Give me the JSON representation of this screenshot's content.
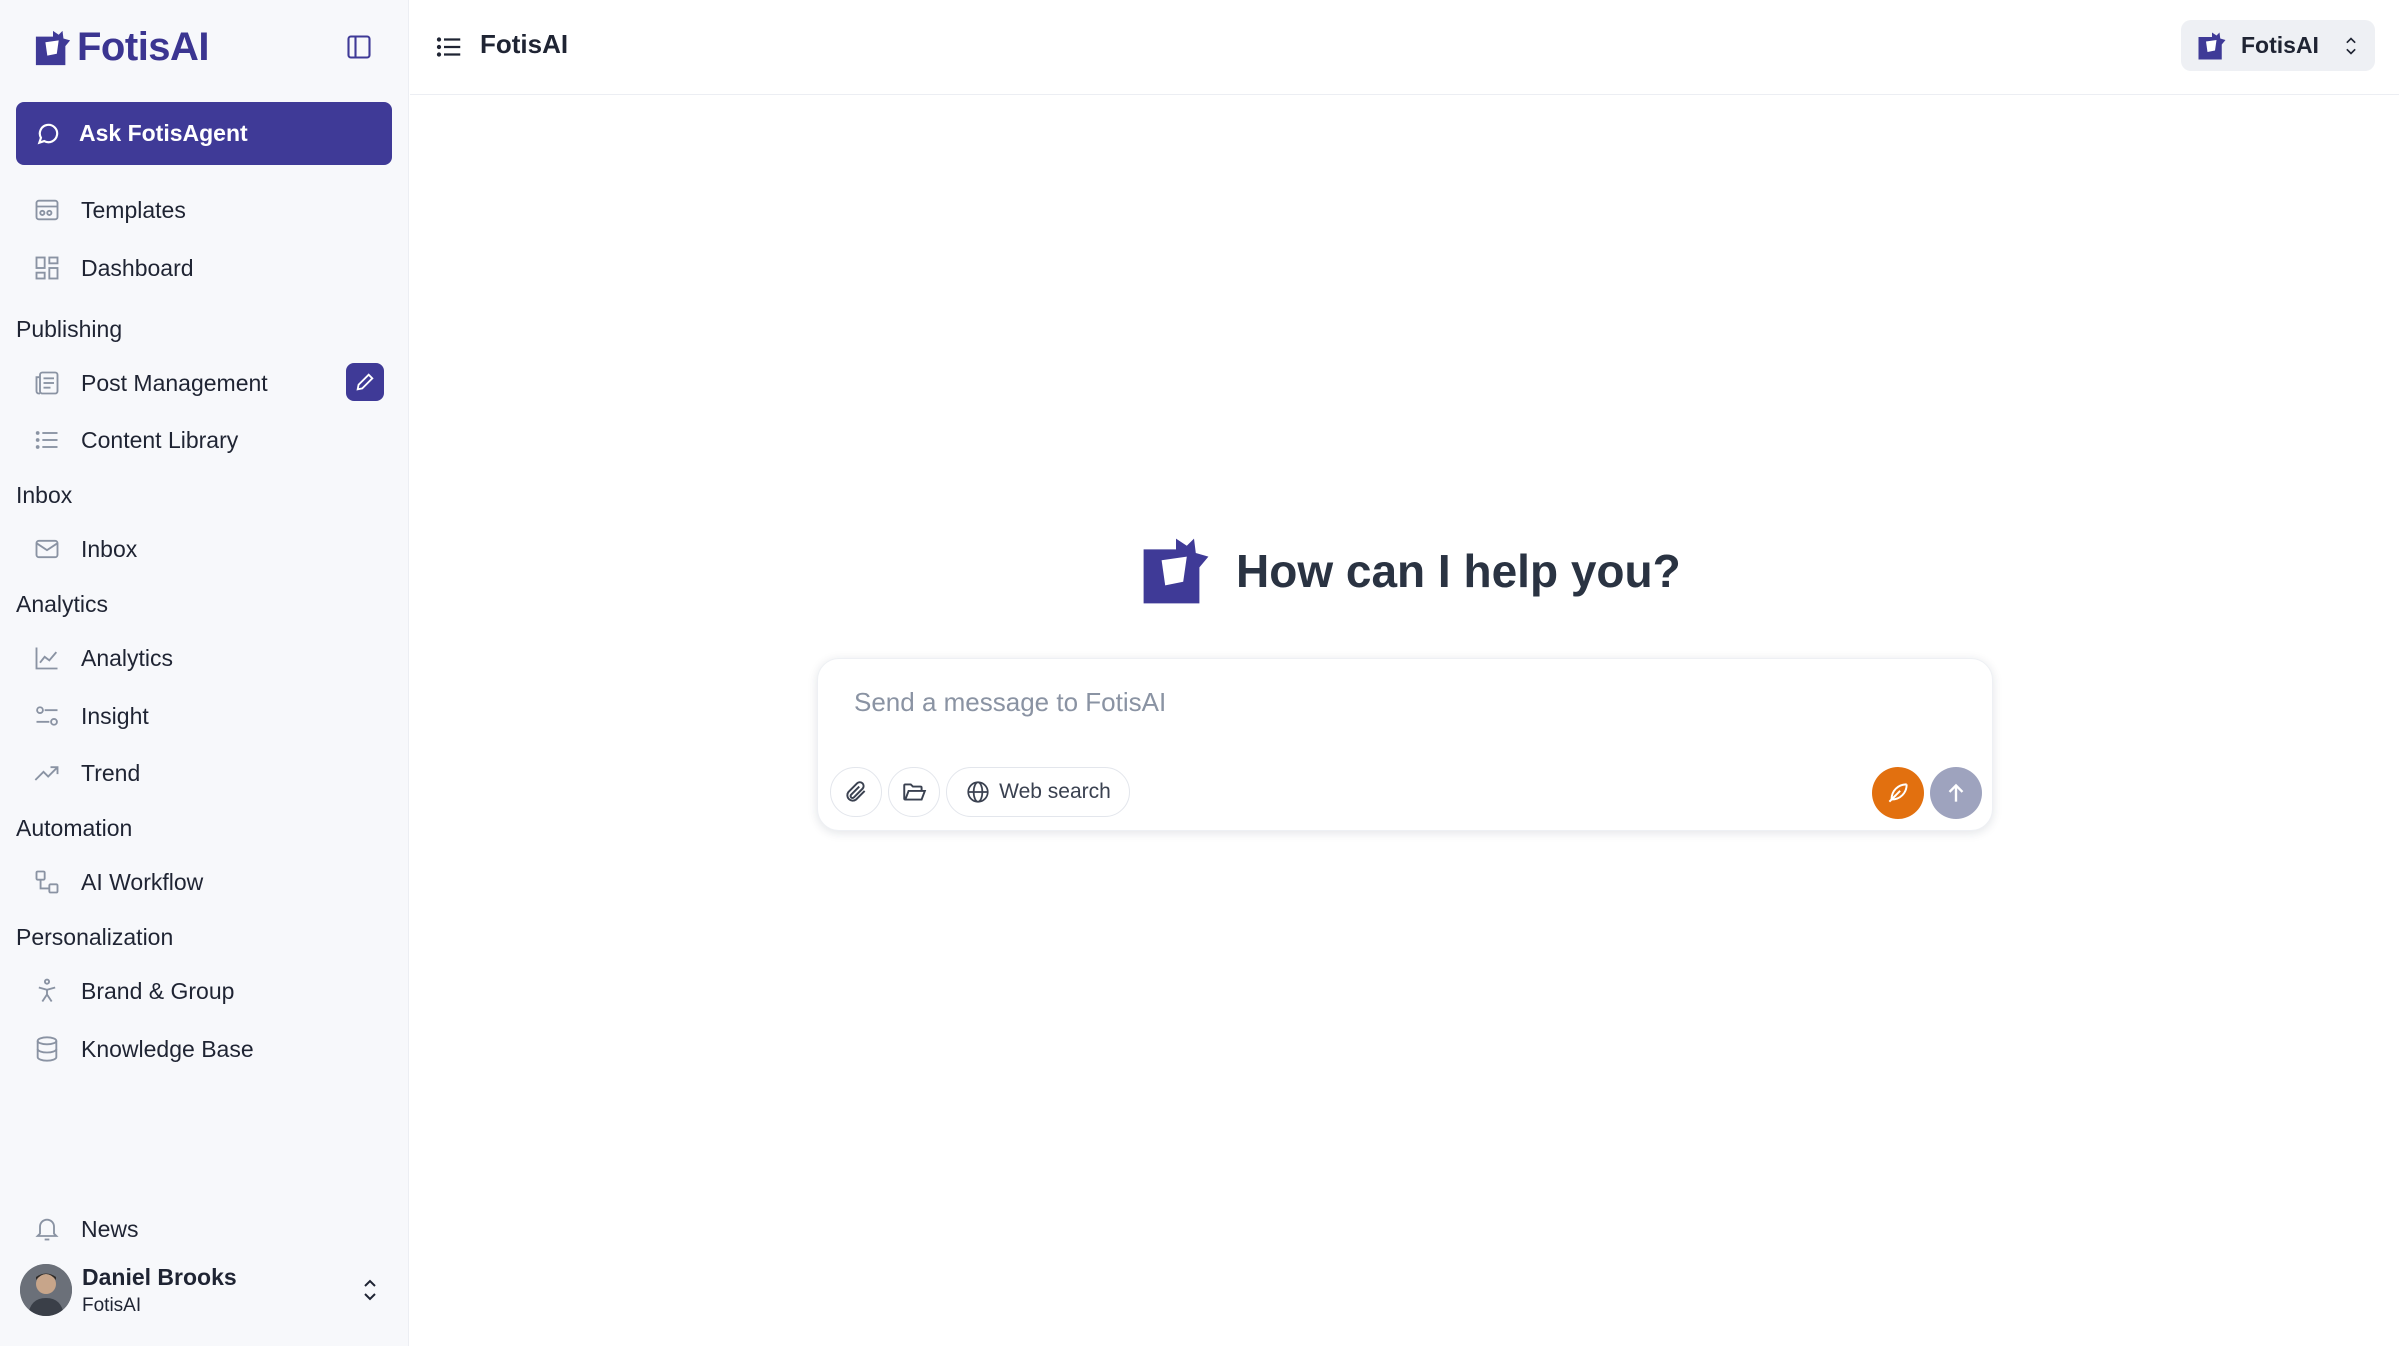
{
  "app": {
    "brand": "FotisAI",
    "brand_color": "#3f3a97",
    "accent_orange": "#e2700f"
  },
  "sidebar": {
    "ask_button": "Ask FotisAgent",
    "items_top": [
      {
        "label": "Templates",
        "icon": "templates-icon"
      },
      {
        "label": "Dashboard",
        "icon": "dashboard-icon"
      }
    ],
    "sections": [
      {
        "title": "Publishing",
        "items": [
          {
            "label": "Post Management",
            "icon": "post-icon"
          },
          {
            "label": "Content Library",
            "icon": "list-icon"
          }
        ]
      },
      {
        "title": "Inbox",
        "items": [
          {
            "label": "Inbox",
            "icon": "mail-icon"
          }
        ]
      },
      {
        "title": "Analytics",
        "items": [
          {
            "label": "Analytics",
            "icon": "line-chart-icon"
          },
          {
            "label": "Insight",
            "icon": "insight-icon"
          },
          {
            "label": "Trend",
            "icon": "trend-icon"
          }
        ]
      },
      {
        "title": "Automation",
        "items": [
          {
            "label": "AI Workflow",
            "icon": "workflow-icon"
          }
        ]
      },
      {
        "title": "Personalization",
        "items": [
          {
            "label": "Brand & Group",
            "icon": "person-icon"
          },
          {
            "label": "Knowledge Base",
            "icon": "database-icon"
          }
        ]
      }
    ],
    "news": "News",
    "user": {
      "name": "Daniel Brooks",
      "org": "FotisAI"
    }
  },
  "topbar": {
    "title": "FotisAI",
    "workspace": "FotisAI"
  },
  "main": {
    "greeting": "How can I help you?",
    "composer": {
      "placeholder": "Send a message to FotisAI",
      "web_search": "Web search"
    }
  }
}
